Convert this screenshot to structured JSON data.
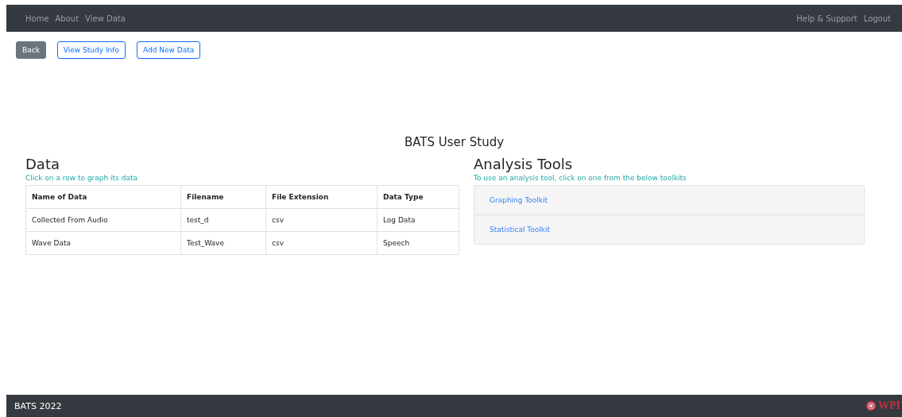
{
  "nav": {
    "left": [
      "Home",
      "About",
      "View Data"
    ],
    "right": [
      "Help & Support",
      "Logout"
    ]
  },
  "buttons": [
    {
      "label": "Back",
      "kind": "secondary"
    },
    {
      "label": "View Study Info",
      "kind": "outline"
    },
    {
      "label": "Add New Data",
      "kind": "outline"
    }
  ],
  "title": "BATS User Study",
  "data": {
    "heading": "Data",
    "hint": "Click on a row to graph its data",
    "columns": [
      "Name of Data",
      "Filename",
      "File Extension",
      "Data Type"
    ],
    "rows": [
      [
        "Collected From Audio",
        "test_d",
        "csv",
        "Log Data"
      ],
      [
        "Wave Data",
        "Test_Wave",
        "csv",
        "Speech"
      ]
    ]
  },
  "tools": {
    "heading": "Analysis Tools",
    "hint": "To use an analysis tool, click on one from the below toolkits",
    "items": [
      "Graphing Toolkit",
      "Statistical Toolkit"
    ]
  },
  "footer": {
    "text": "BATS 2022",
    "logo": "WPI"
  }
}
